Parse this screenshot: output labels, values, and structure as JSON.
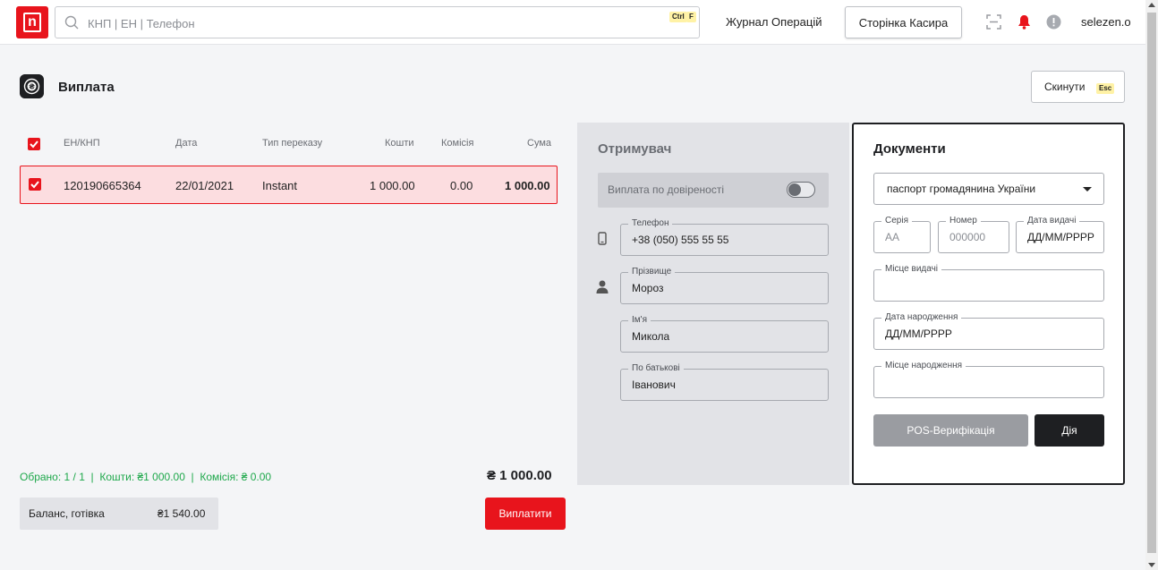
{
  "topbar": {
    "logo_letter": "n",
    "search_placeholder": "КНП | ЕН | Телефон",
    "search_hotkey_1": "Ctrl",
    "search_hotkey_2": "F",
    "operations_log": "Журнал Операцій",
    "cashier_page": "Сторінка Касира",
    "username": "selezen.o",
    "icons": [
      "qr-scan-icon",
      "bell-icon",
      "alert-icon"
    ],
    "bell_color": "#e8141c"
  },
  "page": {
    "title": "Виплата",
    "reset_label": "Скинути",
    "reset_hotkey": "Esc"
  },
  "table": {
    "headers": {
      "id": "ЕН/КНП",
      "date": "Дата",
      "type": "Тип переказу",
      "funds": "Кошти",
      "fee": "Комісія",
      "sum": "Сума"
    },
    "rows": [
      {
        "id": "120190665364",
        "date": "22/01/2021",
        "type": "Instant",
        "funds": "1 000.00",
        "fee": "0.00",
        "sum": "1 000.00",
        "checked": true
      }
    ]
  },
  "summary": {
    "text": "Обрано: 1 / 1  |  Кошти: ₴1 000.00  |  Комісія: ₴ 0.00",
    "total": "₴ 1 000.00",
    "balance_label": "Баланс, готівка",
    "balance_value": "₴1 540.00",
    "pay_label": "Виплатити"
  },
  "recipient": {
    "title": "Отримувач",
    "proxy_label": "Виплата по довіреності",
    "proxy_enabled": false,
    "phone_label": "Телефон",
    "phone_value": "+38 (050) 555 55 55",
    "surname_label": "Прізвище",
    "surname_value": "Мороз",
    "name_label": "Ім'я",
    "name_value": "Микола",
    "patronymic_label": "По батькові",
    "patronymic_value": "Іванович"
  },
  "documents": {
    "title": "Документи",
    "doc_type": "паспорт громадянина України",
    "series_label": "Серія",
    "series_placeholder": "АА",
    "number_label": "Номер",
    "number_placeholder": "000000",
    "issue_date_label": "Дата видачі",
    "issue_date_value": "ДД/ММ/РРРР",
    "issue_place_label": "Місце видачі",
    "issue_place_value": "",
    "birth_date_label": "Дата народження",
    "birth_date_value": "ДД/ММ/РРРР",
    "birth_place_label": "Місце народження",
    "birth_place_value": "",
    "pos_label": "POS-Верифікація",
    "diia_label": "Дія"
  }
}
